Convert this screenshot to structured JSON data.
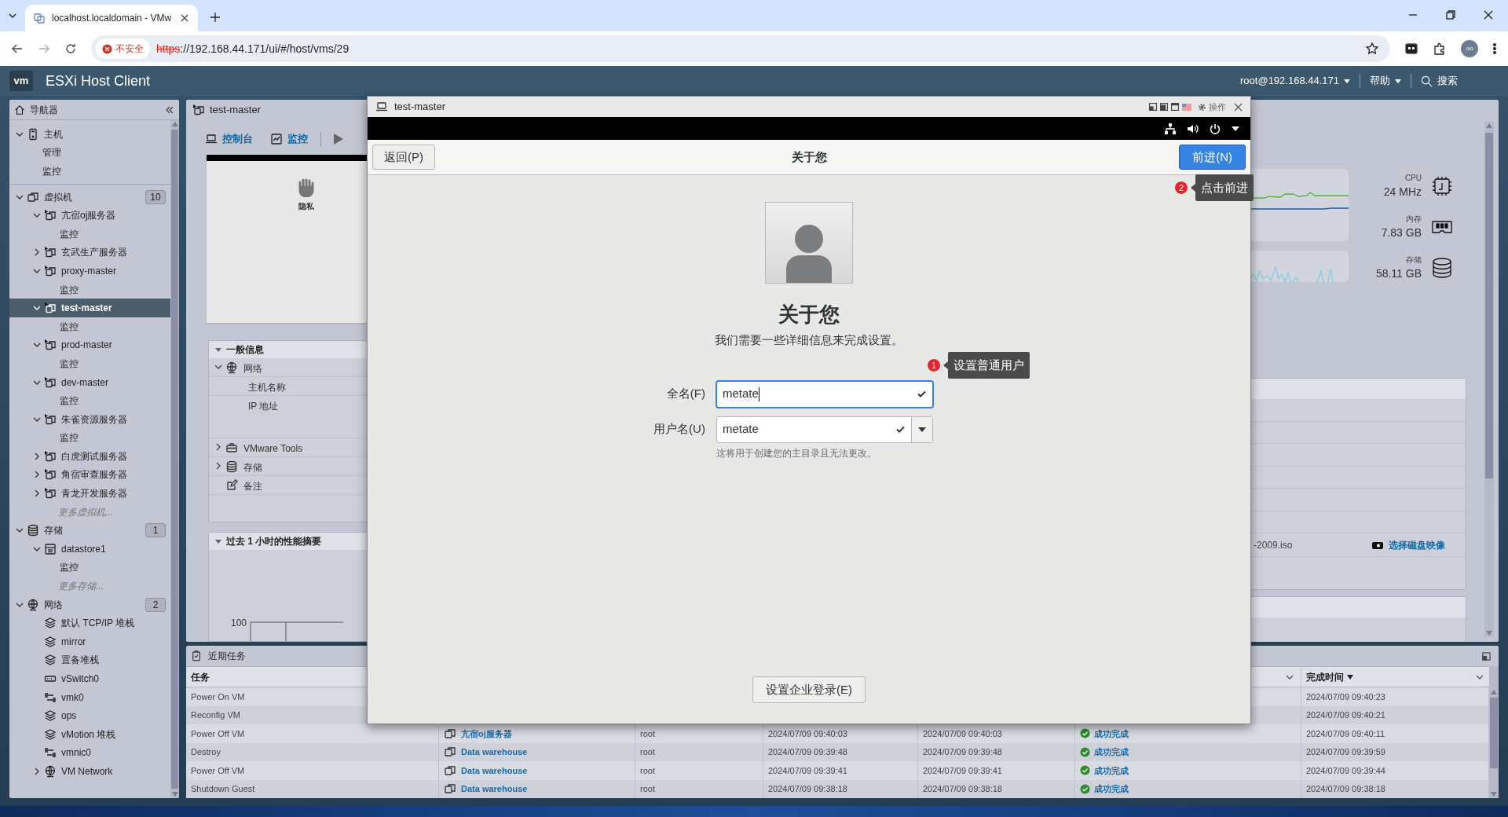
{
  "browser": {
    "tab_title": "localhost.localdomain - VMw",
    "security_label": "不安全",
    "url_scheme": "https",
    "url_rest": "://192.168.44.171/ui/#/host/vms/29",
    "profile": "oo"
  },
  "app": {
    "logo": "vm",
    "title": "ESXi Host Client",
    "user": "root@192.168.44.171",
    "help": "帮助",
    "search": "搜索"
  },
  "navigator": {
    "title": "导航器",
    "sections": [
      {
        "label": "主机",
        "kind": "host",
        "expanded": true,
        "children": [
          {
            "label": "管理"
          },
          {
            "label": "监控"
          }
        ]
      },
      {
        "label": "虚拟机",
        "kind": "vms",
        "count": "10",
        "expanded": true,
        "children": [
          {
            "label": "亢宿oj服务器",
            "kind": "vm",
            "expanded": true,
            "selected": false,
            "children": [
              {
                "label": "监控"
              }
            ]
          },
          {
            "label": "玄武生产服务器",
            "kind": "vm",
            "expanded": false,
            "selected": false
          },
          {
            "label": "proxy-master",
            "kind": "vm",
            "expanded": true,
            "selected": false,
            "children": [
              {
                "label": "监控"
              }
            ]
          },
          {
            "label": "test-master",
            "kind": "vm",
            "expanded": true,
            "selected": true,
            "children": [
              {
                "label": "监控"
              }
            ]
          },
          {
            "label": "prod-master",
            "kind": "vm",
            "expanded": true,
            "selected": false,
            "children": [
              {
                "label": "监控"
              }
            ]
          },
          {
            "label": "dev-master",
            "kind": "vm",
            "expanded": true,
            "selected": false,
            "children": [
              {
                "label": "监控"
              }
            ]
          },
          {
            "label": "朱雀资源服务器",
            "kind": "vm",
            "expanded": true,
            "selected": false,
            "children": [
              {
                "label": "监控"
              }
            ]
          },
          {
            "label": "白虎测试服务器",
            "kind": "vm",
            "expanded": false,
            "selected": false
          },
          {
            "label": "角宿审查服务器",
            "kind": "vm",
            "expanded": false,
            "selected": false
          },
          {
            "label": "青龙开发服务器",
            "kind": "vm",
            "expanded": false,
            "selected": false
          },
          {
            "label": "更多虚拟机...",
            "kind": "more"
          }
        ]
      },
      {
        "label": "存储",
        "kind": "storage",
        "count": "1",
        "expanded": true,
        "children": [
          {
            "label": "datastore1",
            "kind": "datastore",
            "expanded": true,
            "children": [
              {
                "label": "监控"
              }
            ]
          },
          {
            "label": "更多存储...",
            "kind": "more"
          }
        ]
      },
      {
        "label": "网络",
        "kind": "network",
        "count": "2",
        "expanded": true,
        "children": [
          {
            "label": "默认 TCP/IP 堆栈",
            "kind": "stack"
          },
          {
            "label": "mirror",
            "kind": "stack"
          },
          {
            "label": "置备堆栈",
            "kind": "stack"
          },
          {
            "label": "vSwitch0",
            "kind": "switch"
          },
          {
            "label": "vmk0",
            "kind": "nic"
          },
          {
            "label": "ops",
            "kind": "stack"
          },
          {
            "label": "vMotion 堆栈",
            "kind": "stack"
          },
          {
            "label": "vmnic0",
            "kind": "nic"
          },
          {
            "label": "VM Network",
            "kind": "network",
            "expanded": false
          }
        ]
      }
    ]
  },
  "vm_panel": {
    "title": "test-master",
    "toolbar": [
      {
        "label": "控制台",
        "kind": "console"
      },
      {
        "label": "监控",
        "kind": "monitor"
      }
    ],
    "thumbnail": {
      "title": "隐私"
    },
    "general": {
      "title": "一般信息",
      "rows": [
        {
          "label": "网络",
          "kind": "network",
          "expanded": true
        },
        {
          "label": "主机名称",
          "kind": "field"
        },
        {
          "label": "IP 地址",
          "kind": "field"
        },
        {
          "label": "VMware Tools",
          "kind": "tools",
          "expanded": false
        },
        {
          "label": "存储",
          "kind": "storage",
          "expanded": false
        },
        {
          "label": "备注",
          "kind": "note"
        }
      ]
    },
    "performance": {
      "title": "过去 1 小时的性能摘要",
      "tick_label": "100"
    },
    "stats": [
      {
        "label": "CPU",
        "value": "24 MHz",
        "kind": "cpu"
      },
      {
        "label": "内存",
        "value": "7.83 GB",
        "kind": "memory"
      },
      {
        "label": "存储",
        "value": "58.11 GB",
        "kind": "storage"
      }
    ],
    "hardware": {
      "iso_text": "-2009.iso",
      "action": "选择磁盘映像"
    }
  },
  "tasks": {
    "title": "近期任务",
    "headers": {
      "task": "任务",
      "completed": "完成时间"
    },
    "rows": [
      {
        "task": "Power On VM",
        "completed": "2024/07/09 09:40:23"
      },
      {
        "task": "Reconfig VM",
        "completed": "2024/07/09 09:40:21"
      },
      {
        "task": "Power Off VM",
        "target": "亢宿oj服务器",
        "initiator": "root",
        "queued": "2024/07/09 09:40:03",
        "started": "2024/07/09 09:40:03",
        "result": "成功完成",
        "completed": "2024/07/09 09:40:11"
      },
      {
        "task": "Destroy",
        "target": "Data warehouse",
        "initiator": "root",
        "queued": "2024/07/09 09:39:48",
        "started": "2024/07/09 09:39:48",
        "result": "成功完成",
        "completed": "2024/07/09 09:39:59"
      },
      {
        "task": "Power Off VM",
        "target": "Data warehouse",
        "initiator": "root",
        "queued": "2024/07/09 09:39:41",
        "started": "2024/07/09 09:39:41",
        "result": "成功完成",
        "completed": "2024/07/09 09:39:44"
      },
      {
        "task": "Shutdown Guest",
        "target": "Data warehouse",
        "initiator": "root",
        "queued": "2024/07/09 09:38:18",
        "started": "2024/07/09 09:38:18",
        "result": "成功完成",
        "completed": "2024/07/09 09:38:18"
      }
    ]
  },
  "console": {
    "window_title": "test-master",
    "menu_label": "操作",
    "back": "返回(P)",
    "heading": "关于您",
    "next": "前进(N)",
    "page_title": "关于您",
    "subtitle": "我们需要一些详细信息来完成设置。",
    "fields": [
      {
        "label": "全名(F)",
        "value": "metate",
        "focused": true,
        "valid": true,
        "dropdown": false
      },
      {
        "label": "用户名(U)",
        "value": "metate",
        "focused": false,
        "valid": true,
        "dropdown": true
      }
    ],
    "hint": "这将用于创建您的主目录且无法更改。",
    "enterprise": "设置企业登录(E)"
  },
  "annotations": [
    {
      "number": "1",
      "text": "设置普通用户"
    },
    {
      "number": "2",
      "text": "点击前进"
    }
  ]
}
